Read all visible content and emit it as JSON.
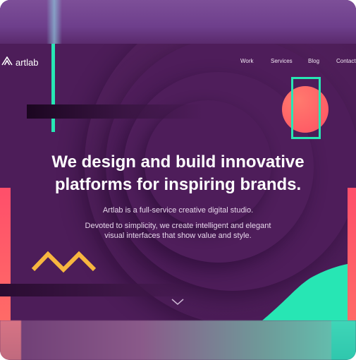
{
  "brand": {
    "logo_text": "artlab"
  },
  "nav": {
    "items": [
      "Work",
      "Services",
      "Blog",
      "Contact"
    ]
  },
  "hero": {
    "headline_line1": "We design and build innovative",
    "headline_line2": "platforms for inspiring brands.",
    "tagline": "Artlab is a full-service creative digital studio.",
    "description_line1": "Devoted to simplicity, we create intelligent and elegant",
    "description_line2": "visual interfaces that show value and style."
  },
  "icons": {
    "logo": "triangle-logo-icon",
    "scroll": "chevron-down-icon"
  },
  "colors": {
    "background": "#4d1d59",
    "teal": "#27e6b4",
    "coral": "#ff5e66",
    "yellow": "#f7b63f"
  }
}
